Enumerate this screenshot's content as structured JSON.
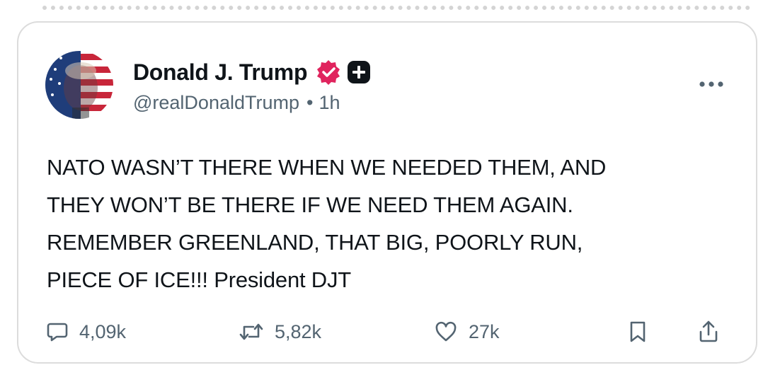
{
  "post": {
    "author": {
      "display_name": "Donald J. Trump",
      "handle": "@realDonaldTrump",
      "separator": "•",
      "time_ago": "1h",
      "badges": [
        "verified-badge-icon",
        "plus-badge-icon"
      ]
    },
    "text": "NATO WASN’T THERE WHEN WE NEEDED THEM, AND\nTHEY WON’T BE THERE IF WE NEED THEM AGAIN.\nREMEMBER GREENLAND, THAT BIG, POORLY RUN,\nPIECE OF ICE!!! President DJT",
    "stats": {
      "replies": "4,09k",
      "reposts": "5,82k",
      "likes": "27k"
    }
  },
  "colors": {
    "text_primary": "#0f1419",
    "text_secondary": "#536471",
    "verified_badge": "#e0245e",
    "card_border": "#dcdcdc"
  },
  "icons": {
    "more": "more-horizontal-icon",
    "reply": "reply-bubble-icon",
    "repost": "repost-icon",
    "like": "heart-icon",
    "bookmark": "bookmark-icon",
    "share": "share-icon"
  }
}
